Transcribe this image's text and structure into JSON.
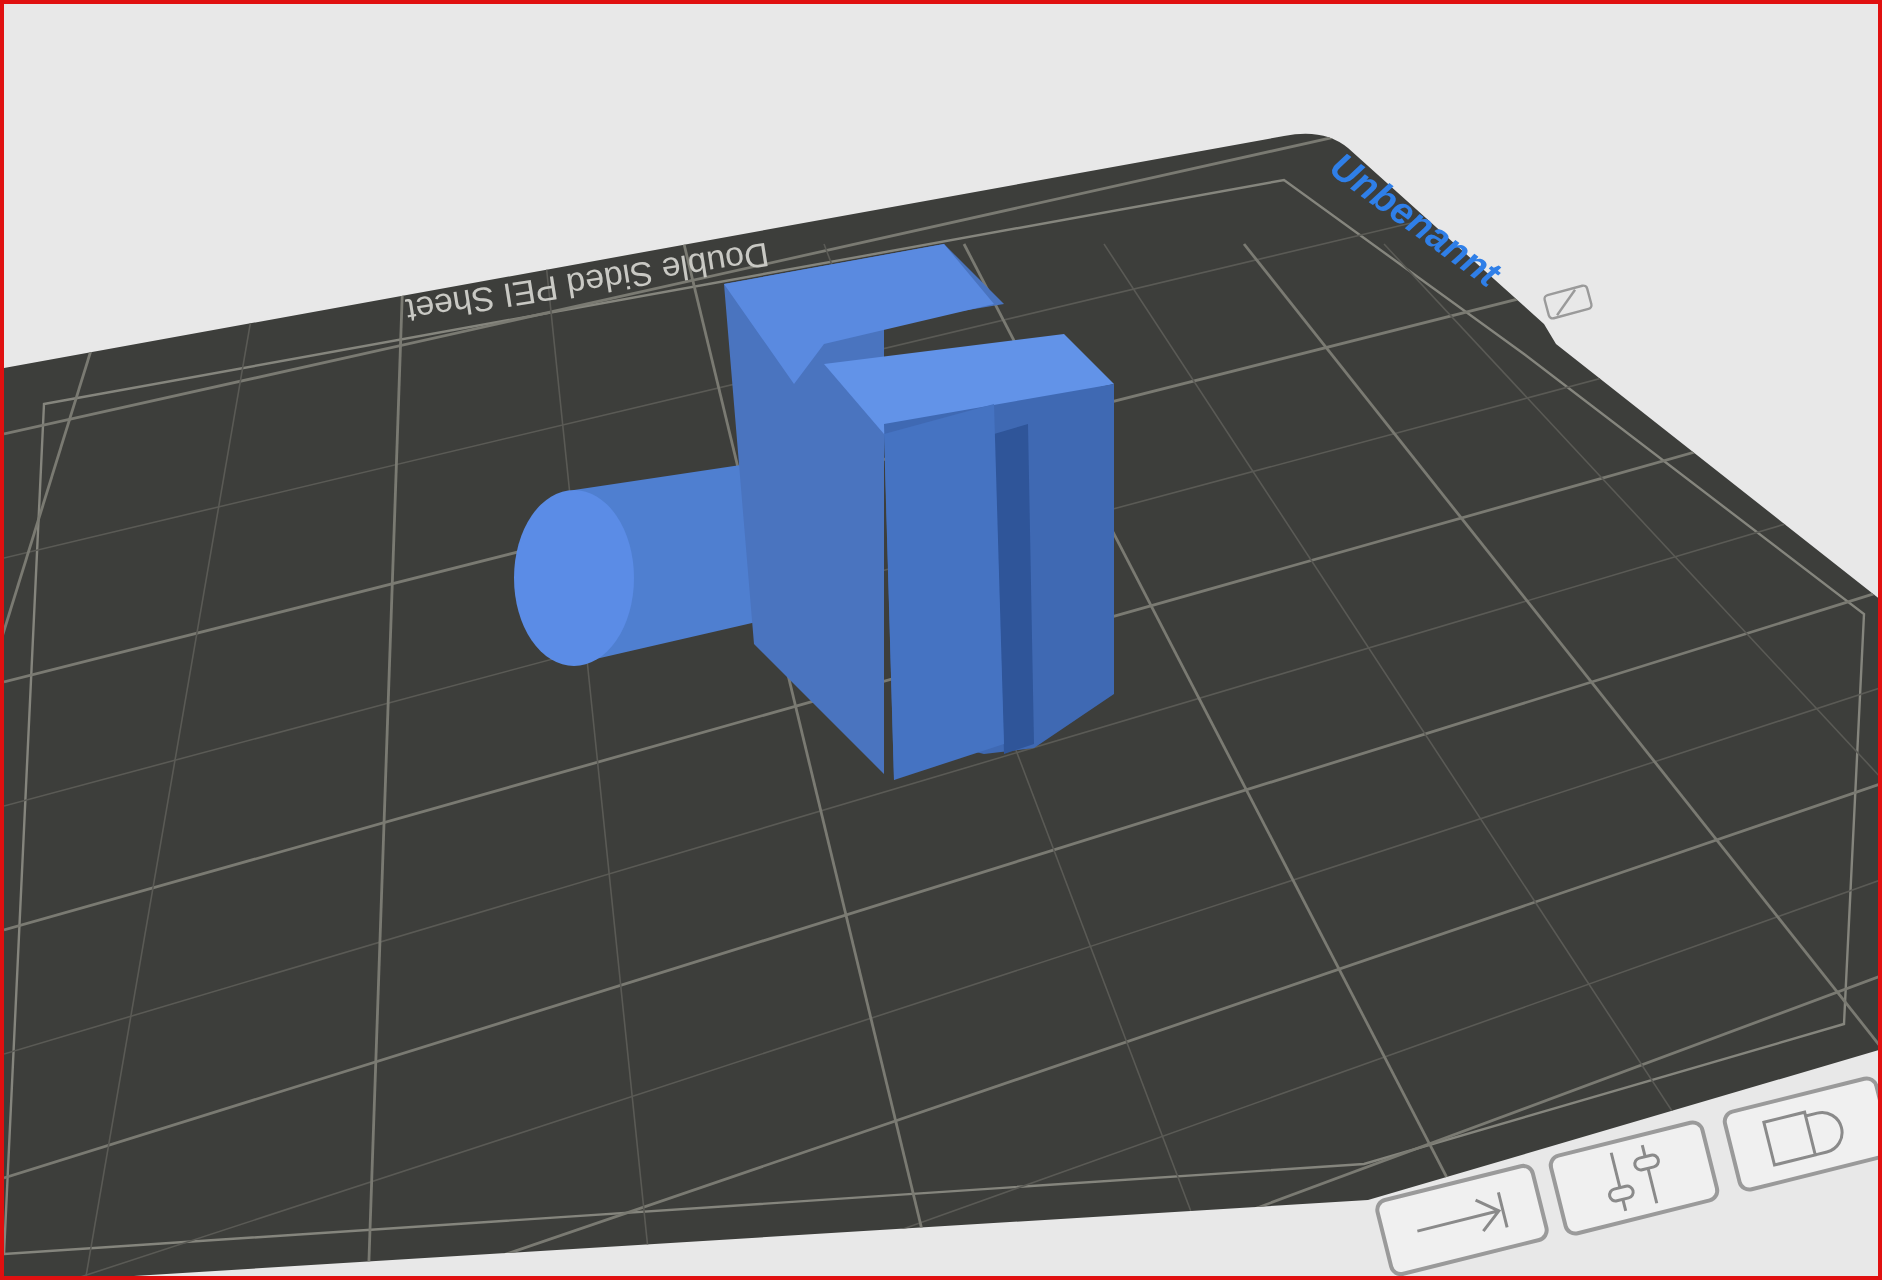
{
  "plate_name": {
    "text": "Unbenannt"
  },
  "bed": {
    "label": "Double Sided PEI Sheet"
  }
}
